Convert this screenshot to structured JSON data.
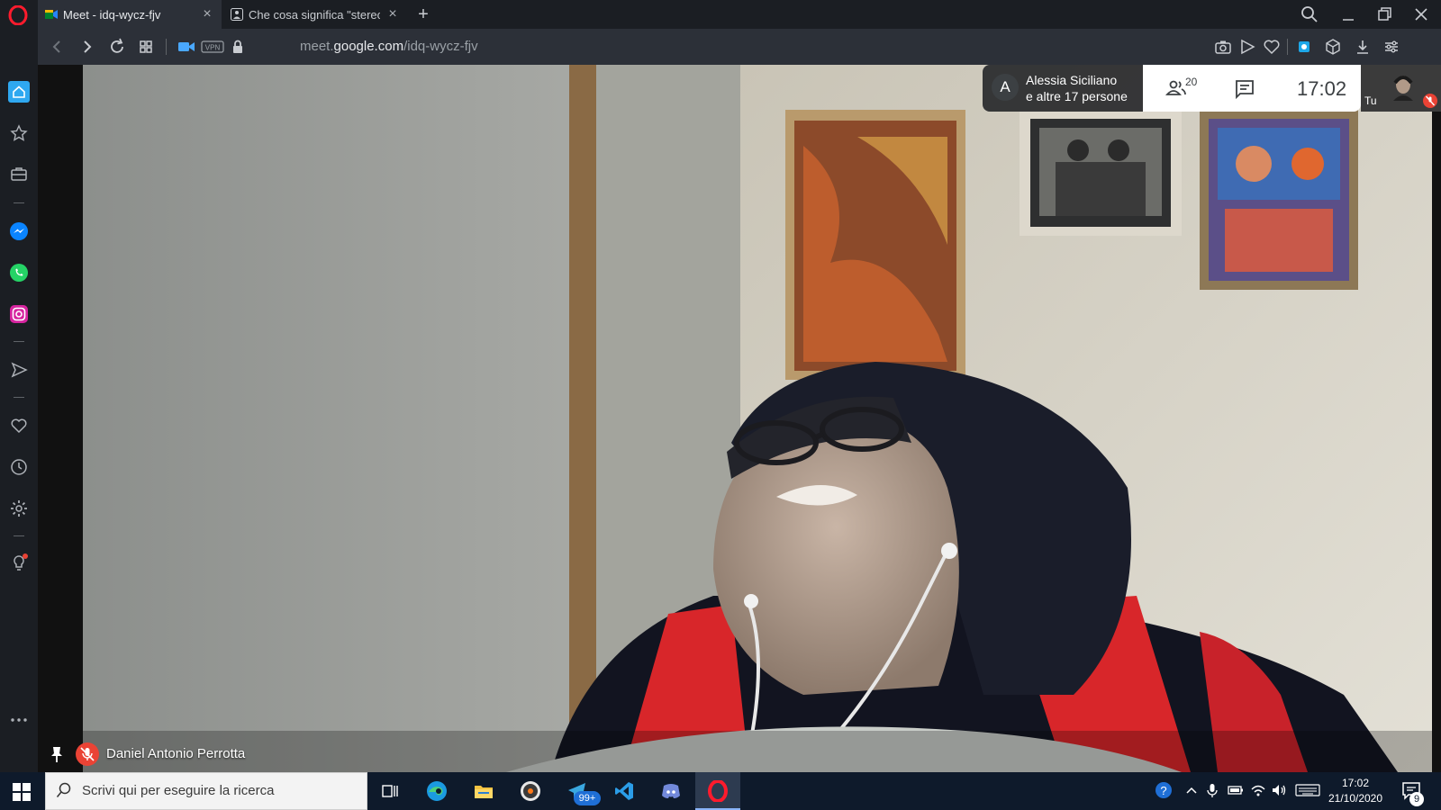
{
  "browser": {
    "tabs": [
      {
        "title": "Meet - idq-wycz-fjv",
        "active": true
      },
      {
        "title": "Che cosa significa \"stereoti",
        "active": false
      }
    ],
    "url_prefix": "meet.",
    "url_host": "google.com",
    "url_path": "/idq-wycz-fjv"
  },
  "meet": {
    "avatar_letter": "A",
    "participant_line1": "Alessia Siciliano",
    "participant_line2": "e altre 17 persone",
    "participant_count": "20",
    "time": "17:02",
    "self_label": "Tu",
    "speaker_name": "Daniel Antonio Perrotta"
  },
  "taskbar": {
    "search_placeholder": "Scrivi qui per eseguire la ricerca",
    "telegram_badge": "99+",
    "clock_time": "17:02",
    "clock_date": "21/10/2020",
    "notification_count": "9"
  },
  "colors": {
    "chrome_dark": "#1b1e23",
    "addressbar": "#2c3038",
    "meet_red": "#ea4335",
    "taskbar": "#0e1a2b"
  }
}
